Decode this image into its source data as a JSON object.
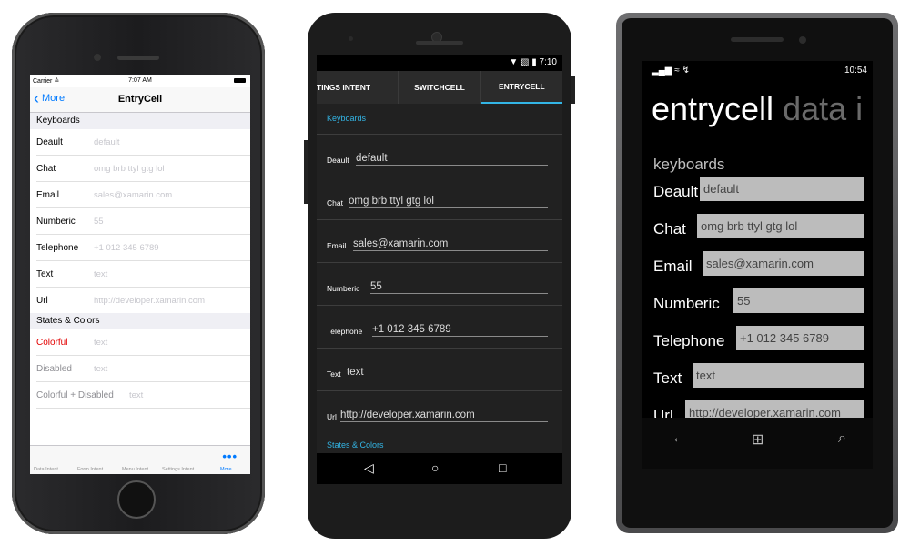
{
  "ios": {
    "status": {
      "carrier": "Carrier ≙",
      "time": "7:07 AM"
    },
    "nav": {
      "back_label": "More",
      "title": "EntryCell"
    },
    "sections": [
      {
        "title": "Keyboards"
      },
      {
        "title": "States & Colors"
      }
    ],
    "rows": [
      {
        "label": "Deault",
        "value": "default"
      },
      {
        "label": "Chat",
        "value": "omg brb ttyl gtg lol"
      },
      {
        "label": "Email",
        "value": "sales@xamarin.com"
      },
      {
        "label": "Numberic",
        "value": "55"
      },
      {
        "label": "Telephone",
        "value": "+1 012 345 6789"
      },
      {
        "label": "Text",
        "value": "text"
      },
      {
        "label": "Url",
        "value": "http://developer.xamarin.com"
      }
    ],
    "state_rows": [
      {
        "label": "Colorful",
        "value": "text"
      },
      {
        "label": "Disabled",
        "value": "text"
      },
      {
        "label": "Colorful + Disabled",
        "value": "text"
      }
    ],
    "tabs": [
      "Data Intent",
      "Form Intent",
      "Menu Intent",
      "Settings Intent",
      "More"
    ],
    "more_dots": "•••",
    "colors": {
      "accent": "#007aff",
      "colorful": "#e20000"
    }
  },
  "android": {
    "status": {
      "time": "7:10",
      "icons": "▼ ▧ ▮"
    },
    "tabs": [
      "TINGS INTENT",
      "SWITCHCELL",
      "ENTRYCELL"
    ],
    "active_tab": 2,
    "section_keyboards": "Keyboards",
    "rows": [
      {
        "label": "Deault",
        "value": "default"
      },
      {
        "label": "Chat",
        "value": "omg brb ttyl gtg lol"
      },
      {
        "label": "Email",
        "value": "sales@xamarin.com"
      },
      {
        "label": "Numberic",
        "value": "55"
      },
      {
        "label": "Telephone",
        "value": "+1 012 345 6789"
      },
      {
        "label": "Text",
        "value": "text"
      },
      {
        "label": "Url",
        "value": "http://developer.xamarin.com"
      }
    ],
    "section_states": "States & Colors",
    "nav": {
      "back": "◁",
      "home": "○",
      "recents": "□"
    },
    "colors": {
      "accent": "#33b5e5"
    }
  },
  "wp": {
    "status": {
      "signal": "▂▄▆ ≈ ↯",
      "time": "10:54"
    },
    "title_main": "entrycell",
    "title_dim": "data i",
    "section": "keyboards",
    "rows": [
      {
        "label": "Deault",
        "value": "default"
      },
      {
        "label": "Chat",
        "value": "omg brb ttyl gtg lol"
      },
      {
        "label": "Email",
        "value": "sales@xamarin.com"
      },
      {
        "label": "Numberic",
        "value": "55"
      },
      {
        "label": "Telephone",
        "value": "+1 012 345 6789"
      },
      {
        "label": "Text",
        "value": "text"
      },
      {
        "label": "Url",
        "value": "http://developer.xamarin.com"
      }
    ],
    "nav": {
      "back": "←",
      "start": "⊞",
      "search": "⌕"
    }
  }
}
